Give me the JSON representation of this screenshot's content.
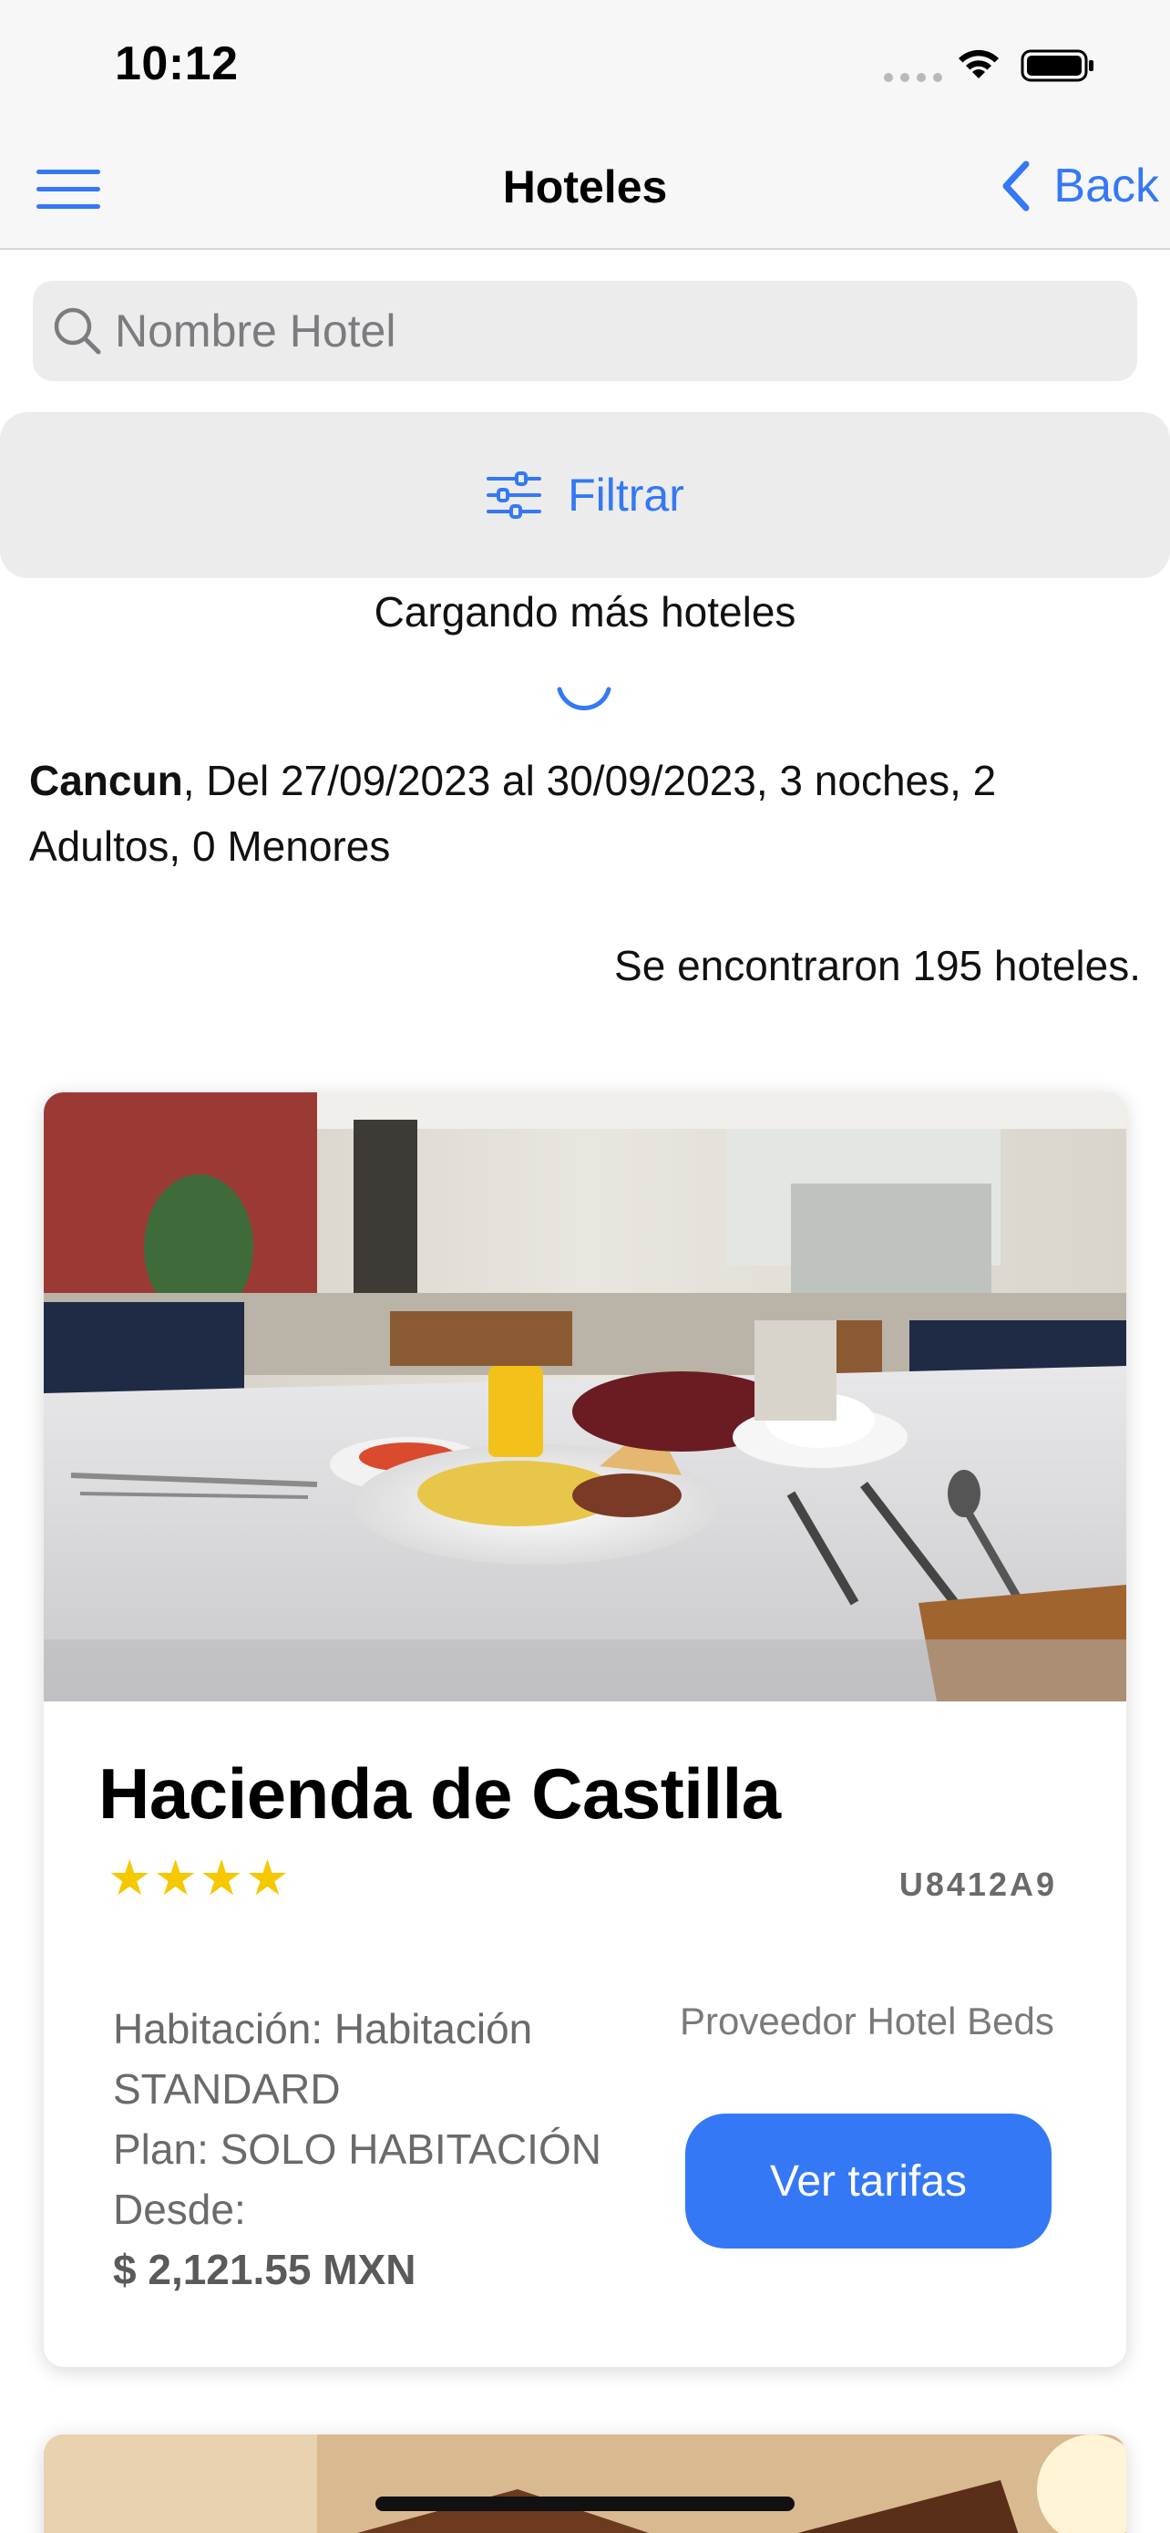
{
  "status_bar": {
    "time": "10:12"
  },
  "nav": {
    "title": "Hoteles",
    "back_label": "Back"
  },
  "search": {
    "placeholder": "Nombre Hotel",
    "value": ""
  },
  "filter": {
    "label": "Filtrar"
  },
  "loading": {
    "text": "Cargando más hoteles"
  },
  "summary": {
    "city": "Cancun",
    "details": ", Del 27/09/2023 al 30/09/2023, 3 noches, 2 Adultos, 0 Menores",
    "result_count": "Se encontraron 195 hoteles."
  },
  "hotels": [
    {
      "name": "Hacienda de Castilla",
      "stars": "★★★★",
      "code": "U8412A9",
      "room": "Habitación: Habitación STANDARD",
      "plan": "Plan: SOLO HABITACIÓN",
      "from_label": "Desde:",
      "price": "$ 2,121.55 MXN",
      "provider": "Proveedor Hotel Beds",
      "rates_button": "Ver tarifas"
    }
  ],
  "colors": {
    "accent": "#3478f6",
    "star": "#f5c800",
    "bar_bg": "#f7f7f7",
    "field_bg": "#ececec"
  },
  "icons": [
    "menu-icon",
    "chevron-left-icon",
    "search-icon",
    "sliders-icon",
    "wifi-icon",
    "battery-icon"
  ]
}
